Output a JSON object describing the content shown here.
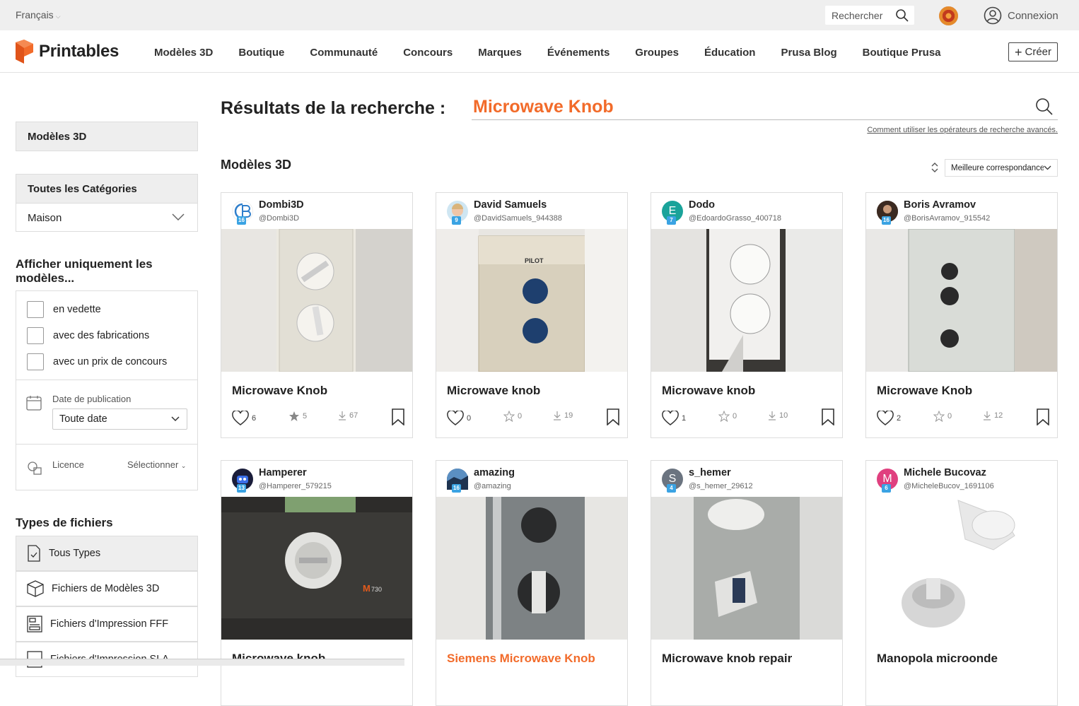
{
  "topbar": {
    "language": "Français",
    "search_placeholder": "Rechercher",
    "login": "Connexion"
  },
  "brand": {
    "name": "Printables",
    "color": "#f26b2a"
  },
  "nav": {
    "items": [
      "Modèles 3D",
      "Boutique",
      "Communauté",
      "Concours",
      "Marques",
      "Événements",
      "Groupes",
      "Éducation",
      "Prusa Blog",
      "Boutique Prusa"
    ],
    "create": "Créer"
  },
  "sidebar": {
    "section_models": "Modèles 3D",
    "categories_header": "Toutes les Catégories",
    "category_value": "Maison",
    "show_only_title": "Afficher uniquement les modèles...",
    "checkboxes": [
      "en vedette",
      "avec des fabrications",
      "avec un prix de concours"
    ],
    "date_label": "Date de publication",
    "date_value": "Toute date",
    "license_label": "Licence",
    "license_value": "Sélectionner",
    "file_types_title": "Types de fichiers",
    "file_types": [
      "Tous Types",
      "Fichiers de Modèles 3D",
      "Fichiers d'Impression FFF",
      "Fichiers d'Impression SLA"
    ]
  },
  "results": {
    "title": "Résultats de la recherche :",
    "query": "Microwave Knob",
    "advanced_link": "Comment utiliser les opérateurs de recherche avancés.",
    "section_title": "Modèles 3D",
    "sort_value": "Meilleure correspondance"
  },
  "cards": [
    {
      "user": "Dombi3D",
      "handle": "@Dombi3D",
      "level": "16",
      "avatar_letter": "",
      "avatar_color": "#ffffff",
      "title": "Microwave Knob",
      "likes": "6",
      "stars": "5",
      "downloads": "67",
      "starred": true
    },
    {
      "user": "David Samuels",
      "handle": "@DavidSamuels_944388",
      "level": "9",
      "avatar_letter": "",
      "avatar_color": "#cfe6f2",
      "title": "Microwave knob",
      "likes": "0",
      "stars": "0",
      "downloads": "19",
      "starred": false
    },
    {
      "user": "Dodo",
      "handle": "@EdoardoGrasso_400718",
      "level": "7",
      "avatar_letter": "E",
      "avatar_color": "#1aa39a",
      "title": "Microwave knob",
      "likes": "1",
      "stars": "0",
      "downloads": "10",
      "starred": false
    },
    {
      "user": "Boris Avramov",
      "handle": "@BorisAvramov_915542",
      "level": "16",
      "avatar_letter": "",
      "avatar_color": "#5a3b2c",
      "title": "Microwave Knob",
      "likes": "2",
      "stars": "0",
      "downloads": "12",
      "starred": false
    },
    {
      "user": "Hamperer",
      "handle": "@Hamperer_579215",
      "level": "13",
      "avatar_letter": "",
      "avatar_color": "#1a1d3a",
      "title": "Microwave knob",
      "likes": "",
      "stars": "",
      "downloads": "",
      "starred": false
    },
    {
      "user": "amazing",
      "handle": "@amazing",
      "level": "16",
      "avatar_letter": "",
      "avatar_color": "#274a6e",
      "title": "Siemens Microwave Knob",
      "likes": "",
      "stars": "",
      "downloads": "",
      "starred": false
    },
    {
      "user": "s_hemer",
      "handle": "@s_hemer_29612",
      "level": "4",
      "avatar_letter": "S",
      "avatar_color": "#6b7480",
      "title": "Microwave knob repair",
      "likes": "",
      "stars": "",
      "downloads": "",
      "starred": false
    },
    {
      "user": "Michele Bucovaz",
      "handle": "@MicheleBucov_1691106",
      "level": "6",
      "avatar_letter": "M",
      "avatar_color": "#e0407f",
      "title": "Manopola microonde",
      "likes": "",
      "stars": "",
      "downloads": "",
      "starred": false
    }
  ]
}
